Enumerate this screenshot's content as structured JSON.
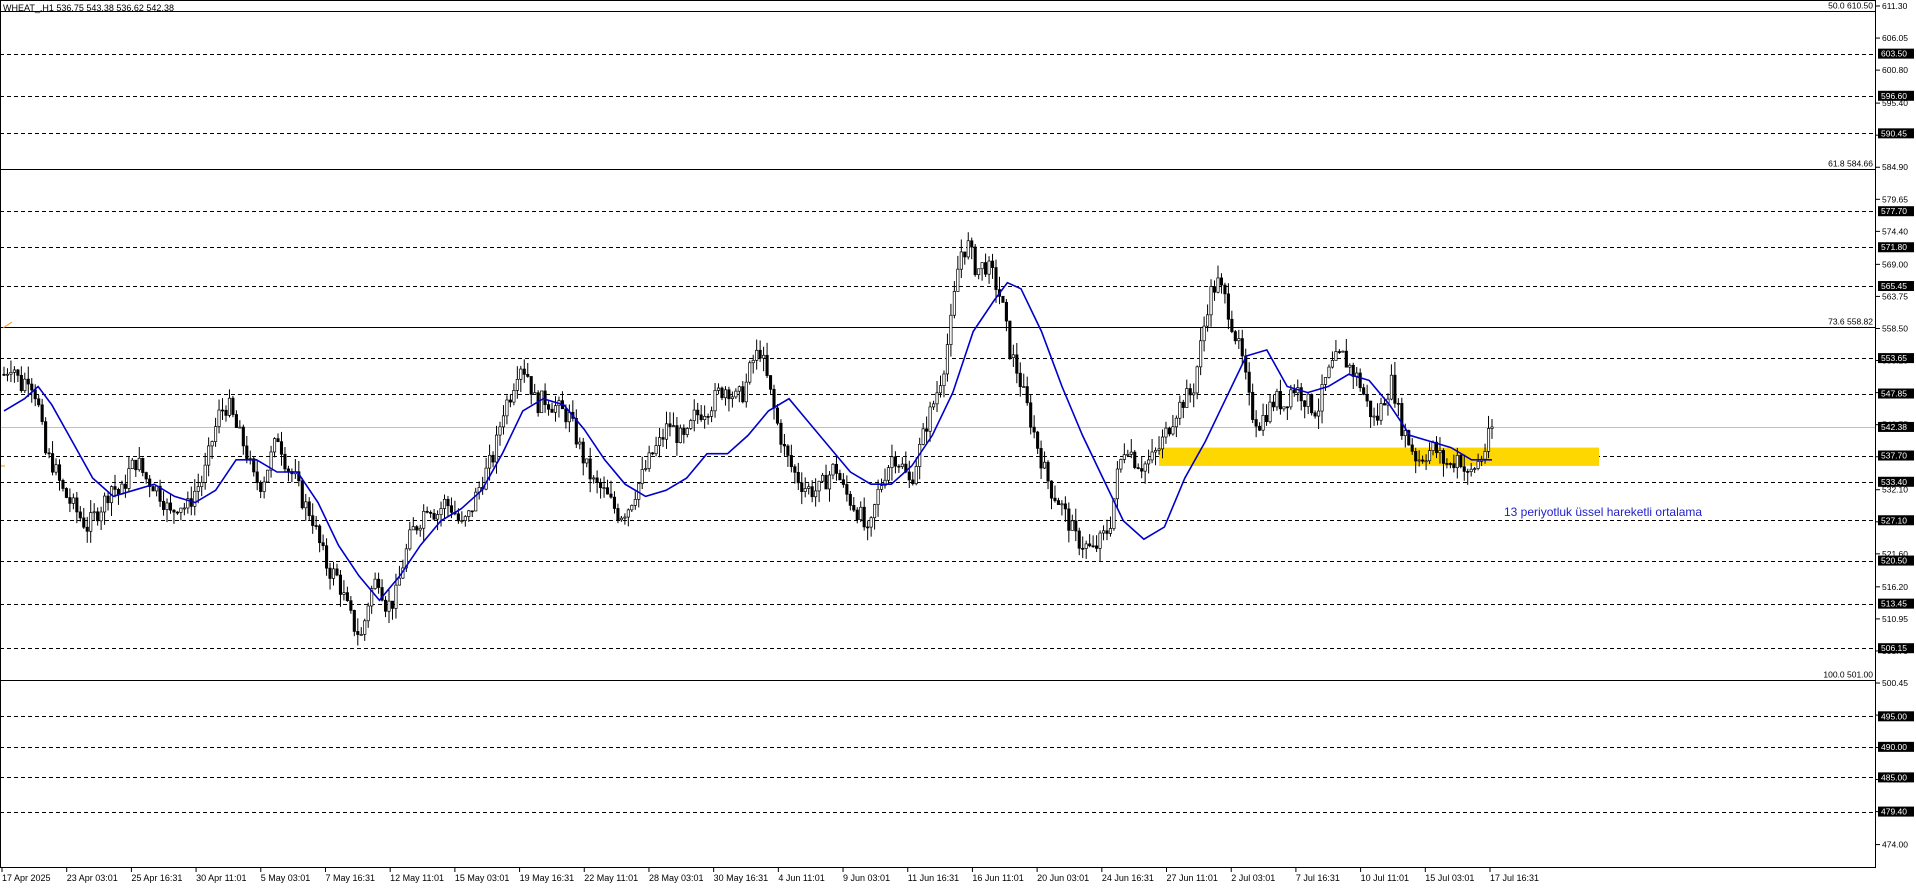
{
  "header": {
    "symbol_line": "WHEAT_,H1  536.75 543.38 536.62 542.38"
  },
  "annotation": {
    "ema_label": "13 periyotluk üssel hareketli ortalama"
  },
  "colors": {
    "ema": "#0000cc",
    "candle": "#000000",
    "zone": "#ffd700",
    "fib_line": "#000000",
    "level_line": "#000000",
    "label_text": "#2222cc",
    "price_box": "#000000",
    "current_line": "#c0c0c0"
  },
  "chart_data": {
    "type": "candlestick",
    "symbol": "WHEAT_",
    "timeframe": "H1",
    "ylim": [
      470,
      611.3
    ],
    "y_ticks": [
      "611.30",
      "606.05",
      "600.80",
      "595.40",
      "590.15",
      "584.90",
      "579.65",
      "574.40",
      "569.00",
      "563.75",
      "558.50",
      "553.25",
      "548.00",
      "542.75",
      "537.50",
      "532.10",
      "526.85",
      "521.60",
      "516.20",
      "510.95",
      "505.70",
      "500.45",
      "495.20",
      "489.90",
      "484.65",
      "479.40",
      "474.00"
    ],
    "x_labels": [
      "17 Apr 2025",
      "23 Apr 03:01",
      "25 Apr 16:31",
      "30 Apr 11:01",
      "5 May 03:01",
      "7 May 16:31",
      "12 May 11:01",
      "15 May 03:01",
      "19 May 16:31",
      "22 May 11:01",
      "28 May 03:01",
      "30 May 16:31",
      "4 Jun 11:01",
      "9 Jun 03:01",
      "11 Jun 16:31",
      "16 Jun 11:01",
      "20 Jun 03:01",
      "24 Jun 16:31",
      "27 Jun 11:01",
      "2 Jul 03:01",
      "7 Jul 16:31",
      "10 Jul 11:01",
      "15 Jul 03:01",
      "17 Jul 16:31"
    ],
    "fib_levels": [
      {
        "label": "50.0 610.50",
        "value": 610.5
      },
      {
        "label": "61.8 584.66",
        "value": 584.66
      },
      {
        "label": "73.6 558.82",
        "value": 558.82
      },
      {
        "label": "100.0 501.00",
        "value": 501.0
      }
    ],
    "horizontal_levels": [
      "603.50",
      "596.60",
      "590.45",
      "577.70",
      "571.80",
      "565.45",
      "553.65",
      "547.85",
      "537.70",
      "533.40",
      "527.10",
      "520.50",
      "513.45",
      "506.15",
      "495.00",
      "490.00",
      "485.00",
      "479.40"
    ],
    "current_price": "542.38",
    "ohlc_last": {
      "open": 536.75,
      "high": 543.38,
      "low": 536.62,
      "close": 542.38
    },
    "support_zone": {
      "low": 536.0,
      "high": 539.0
    },
    "price_path": [
      [
        0,
        551
      ],
      [
        1,
        553
      ],
      [
        2,
        549
      ],
      [
        3,
        551
      ],
      [
        4,
        547
      ],
      [
        5,
        538
      ],
      [
        6,
        536
      ],
      [
        7,
        532
      ],
      [
        8,
        530
      ],
      [
        9,
        528
      ],
      [
        10,
        526
      ],
      [
        11,
        528
      ],
      [
        12,
        530
      ],
      [
        13,
        533
      ],
      [
        14,
        531
      ],
      [
        15,
        535
      ],
      [
        16,
        537
      ],
      [
        17,
        534
      ],
      [
        18,
        533
      ],
      [
        19,
        531
      ],
      [
        20,
        528
      ],
      [
        21,
        530
      ],
      [
        22,
        529
      ],
      [
        23,
        532
      ],
      [
        24,
        534
      ],
      [
        25,
        540
      ],
      [
        26,
        545
      ],
      [
        27,
        546
      ],
      [
        28,
        542
      ],
      [
        29,
        539
      ],
      [
        30,
        534
      ],
      [
        31,
        533
      ],
      [
        32,
        537
      ],
      [
        33,
        541
      ],
      [
        34,
        536
      ],
      [
        35,
        534
      ],
      [
        36,
        530
      ],
      [
        37,
        528
      ],
      [
        38,
        523
      ],
      [
        39,
        519
      ],
      [
        40,
        518
      ],
      [
        41,
        514
      ],
      [
        42,
        510
      ],
      [
        43,
        508
      ],
      [
        44,
        515
      ],
      [
        45,
        518
      ],
      [
        46,
        513
      ],
      [
        47,
        514
      ],
      [
        48,
        520
      ],
      [
        49,
        525
      ],
      [
        50,
        527
      ],
      [
        51,
        530
      ],
      [
        52,
        528
      ],
      [
        53,
        530
      ],
      [
        54,
        529
      ],
      [
        55,
        526
      ],
      [
        56,
        528
      ],
      [
        57,
        532
      ],
      [
        58,
        535
      ],
      [
        59,
        538
      ],
      [
        60,
        545
      ],
      [
        61,
        548
      ],
      [
        62,
        553
      ],
      [
        63,
        551
      ],
      [
        64,
        546
      ],
      [
        65,
        547
      ],
      [
        66,
        546
      ],
      [
        67,
        545
      ],
      [
        68,
        544
      ],
      [
        69,
        540
      ],
      [
        70,
        536
      ],
      [
        71,
        533
      ],
      [
        72,
        532
      ],
      [
        73,
        530
      ],
      [
        74,
        528
      ],
      [
        75,
        529
      ],
      [
        76,
        532
      ],
      [
        77,
        535
      ],
      [
        78,
        538
      ],
      [
        79,
        540
      ],
      [
        80,
        543
      ],
      [
        81,
        541
      ],
      [
        82,
        540
      ],
      [
        83,
        544
      ],
      [
        84,
        545
      ],
      [
        85,
        546
      ],
      [
        86,
        548
      ],
      [
        87,
        549
      ],
      [
        88,
        547
      ],
      [
        89,
        548
      ],
      [
        90,
        553
      ],
      [
        91,
        555
      ],
      [
        92,
        549
      ],
      [
        93,
        543
      ],
      [
        94,
        538
      ],
      [
        95,
        535
      ],
      [
        96,
        533
      ],
      [
        97,
        532
      ],
      [
        98,
        532
      ],
      [
        99,
        534
      ],
      [
        100,
        536
      ],
      [
        101,
        532
      ],
      [
        102,
        530
      ],
      [
        103,
        528
      ],
      [
        104,
        524
      ],
      [
        105,
        531
      ],
      [
        106,
        535
      ],
      [
        107,
        538
      ],
      [
        108,
        536
      ],
      [
        109,
        533
      ],
      [
        110,
        538
      ],
      [
        111,
        543
      ],
      [
        112,
        547
      ],
      [
        113,
        552
      ],
      [
        114,
        560
      ],
      [
        115,
        571
      ],
      [
        116,
        572
      ],
      [
        117,
        568
      ],
      [
        118,
        569
      ],
      [
        119,
        567
      ],
      [
        120,
        563
      ],
      [
        121,
        555
      ],
      [
        122,
        551
      ],
      [
        123,
        546
      ],
      [
        124,
        541
      ],
      [
        125,
        536
      ],
      [
        126,
        532
      ],
      [
        127,
        530
      ],
      [
        128,
        527
      ],
      [
        129,
        524
      ],
      [
        130,
        523
      ],
      [
        131,
        522
      ],
      [
        132,
        524
      ],
      [
        133,
        526
      ],
      [
        134,
        535
      ],
      [
        135,
        540
      ],
      [
        136,
        537
      ],
      [
        137,
        536
      ],
      [
        138,
        537
      ],
      [
        139,
        539
      ],
      [
        140,
        542
      ],
      [
        141,
        545
      ],
      [
        142,
        547
      ],
      [
        143,
        548
      ],
      [
        144,
        556
      ],
      [
        145,
        564
      ],
      [
        146,
        566
      ],
      [
        147,
        563
      ],
      [
        148,
        558
      ],
      [
        149,
        553
      ],
      [
        150,
        545
      ],
      [
        151,
        543
      ],
      [
        152,
        545
      ],
      [
        153,
        547
      ],
      [
        154,
        546
      ],
      [
        155,
        549
      ],
      [
        156,
        548
      ],
      [
        157,
        546
      ],
      [
        158,
        545
      ],
      [
        159,
        550
      ],
      [
        160,
        553
      ],
      [
        161,
        554
      ],
      [
        162,
        552
      ],
      [
        163,
        550
      ],
      [
        164,
        546
      ],
      [
        165,
        543
      ],
      [
        166,
        547
      ],
      [
        167,
        550
      ],
      [
        168,
        543
      ],
      [
        169,
        540
      ],
      [
        170,
        537
      ],
      [
        171,
        538
      ],
      [
        172,
        539
      ],
      [
        173,
        537
      ],
      [
        174,
        536
      ],
      [
        175,
        538
      ],
      [
        176,
        534
      ],
      [
        177,
        536
      ],
      [
        178,
        538
      ],
      [
        179,
        542.38
      ]
    ],
    "ema13_path": [
      [
        0,
        545
      ],
      [
        3,
        547
      ],
      [
        5,
        549
      ],
      [
        7,
        546
      ],
      [
        10,
        540
      ],
      [
        13,
        534
      ],
      [
        16,
        531
      ],
      [
        19,
        532
      ],
      [
        22,
        533
      ],
      [
        25,
        531
      ],
      [
        28,
        530
      ],
      [
        31,
        532
      ],
      [
        34,
        537
      ],
      [
        37,
        537
      ],
      [
        40,
        535
      ],
      [
        43,
        535
      ],
      [
        46,
        530
      ],
      [
        49,
        523
      ],
      [
        52,
        518
      ],
      [
        55,
        514
      ],
      [
        58,
        518
      ],
      [
        61,
        523
      ],
      [
        64,
        527
      ],
      [
        67,
        529
      ],
      [
        70,
        532
      ],
      [
        73,
        538
      ],
      [
        76,
        545
      ],
      [
        79,
        547
      ],
      [
        82,
        546
      ],
      [
        85,
        542
      ],
      [
        88,
        537
      ],
      [
        91,
        533
      ],
      [
        94,
        531
      ],
      [
        97,
        532
      ],
      [
        100,
        534
      ],
      [
        103,
        538
      ],
      [
        106,
        538
      ],
      [
        109,
        541
      ],
      [
        112,
        545
      ],
      [
        115,
        547
      ],
      [
        118,
        543
      ],
      [
        121,
        539
      ],
      [
        124,
        535
      ],
      [
        127,
        533
      ],
      [
        130,
        533
      ],
      [
        133,
        536
      ],
      [
        136,
        541
      ],
      [
        139,
        548
      ],
      [
        142,
        558
      ],
      [
        145,
        563
      ],
      [
        147,
        566
      ],
      [
        149,
        565
      ],
      [
        152,
        558
      ],
      [
        155,
        549
      ],
      [
        158,
        541
      ],
      [
        161,
        534
      ],
      [
        164,
        527
      ],
      [
        167,
        524
      ],
      [
        170,
        526
      ],
      [
        173,
        534
      ],
      [
        176,
        540
      ],
      [
        179,
        547
      ],
      [
        182,
        554
      ],
      [
        185,
        555
      ],
      [
        188,
        549
      ],
      [
        191,
        548
      ],
      [
        194,
        549
      ],
      [
        197,
        551
      ],
      [
        200,
        550
      ],
      [
        203,
        546
      ],
      [
        206,
        541
      ],
      [
        209,
        540
      ],
      [
        212,
        539
      ],
      [
        215,
        537
      ],
      [
        218,
        537
      ]
    ]
  }
}
